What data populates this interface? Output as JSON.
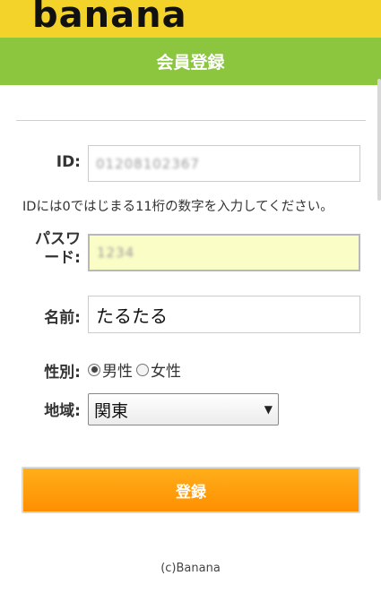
{
  "brand": {
    "logo_text": "banana"
  },
  "header": {
    "title": "会員登録"
  },
  "form": {
    "id": {
      "label": "ID:",
      "value": "01208102367"
    },
    "hint": "IDには0ではじまる11桁の数字を入力してください。",
    "password": {
      "label_line1": "パスワ",
      "label_line2": "ード:",
      "value": "1234",
      "highlight_color": "#fbfdc7"
    },
    "name": {
      "label": "名前:",
      "value": "たるたる"
    },
    "gender": {
      "label": "性別:",
      "options": [
        {
          "label": "男性",
          "selected": true
        },
        {
          "label": "女性",
          "selected": false
        }
      ]
    },
    "region": {
      "label": "地域:",
      "selected": "関東",
      "arrow": "▼"
    },
    "submit_label": "登録"
  },
  "footer": {
    "copyright": "(c)Banana"
  },
  "colors": {
    "topbar": "#f3d32a",
    "titlebar": "#8cc63f",
    "button": "#ff9900"
  }
}
